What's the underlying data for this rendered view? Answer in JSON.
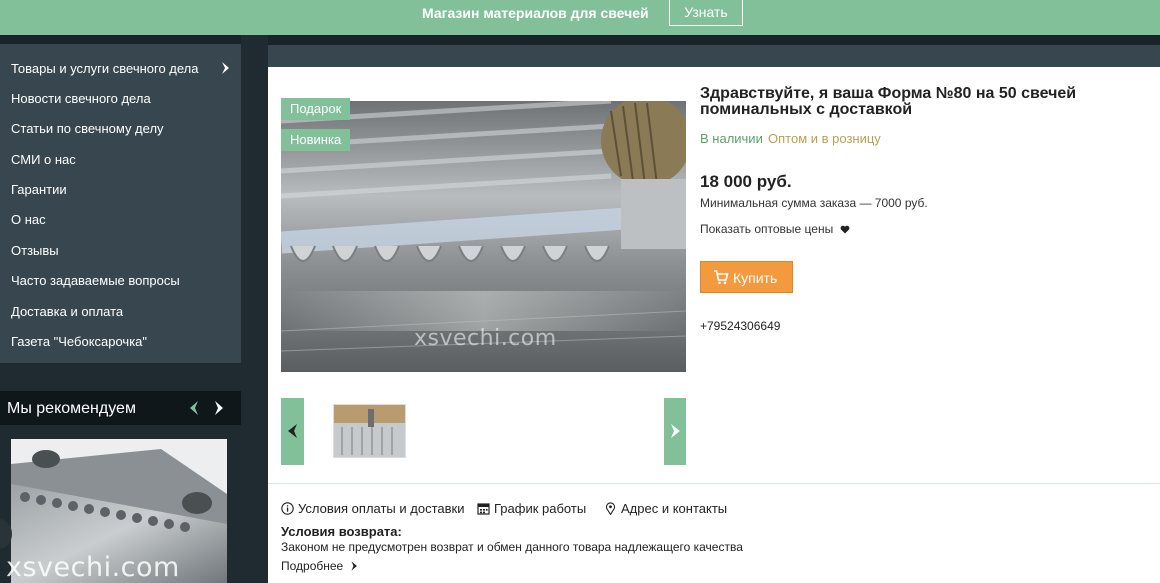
{
  "topbar": {
    "title": "Магазин материалов для свечей",
    "button_label": "Узнать"
  },
  "sidebar": {
    "items": [
      {
        "label": "Товары и услуги свечного дела"
      },
      {
        "label": "Новости свечного дела"
      },
      {
        "label": "Статьи по свечному делу"
      },
      {
        "label": "СМИ о нас"
      },
      {
        "label": "Гарантии"
      },
      {
        "label": "О нас"
      },
      {
        "label": "Отзывы"
      },
      {
        "label": "Часто задаваемые вопросы"
      },
      {
        "label": "Доставка и оплата"
      },
      {
        "label": "Газета \"Чебоксарочка\""
      }
    ],
    "submenu_icon": "chevron-right-icon"
  },
  "recommend": {
    "title": "Мы рекомендуем",
    "watermark": "xsvechi.com"
  },
  "product": {
    "badges": [
      "Подарок",
      "Новинка"
    ],
    "watermark": "xsvechi.com",
    "title": "Здравствуйте, я ваша Форма №80 на 50 свечей поминальных с доставкой",
    "availability": "В наличии",
    "sale_type": "Оптом и в розницу",
    "price": "18 000 руб.",
    "min_order": "Минимальная сумма заказа — 7000 руб.",
    "wholesale_prices": "Показать оптовые цены",
    "buy_label": "Купить",
    "phone": "+79524306649"
  },
  "info_tabs": {
    "payment": "Условия оплаты и доставки",
    "schedule": "График работы",
    "address": "Адрес и контакты"
  },
  "returns": {
    "title": "Условия возврата:",
    "text": "Законом не предусмотрен возврат и обмен данного товара надлежащего качества",
    "more": "Подробнее"
  },
  "colors": {
    "accent_green": "#82c09a",
    "buy_orange": "#f39a3e",
    "sidebar_bg": "#38474f",
    "page_bg": "#1f2a30"
  }
}
